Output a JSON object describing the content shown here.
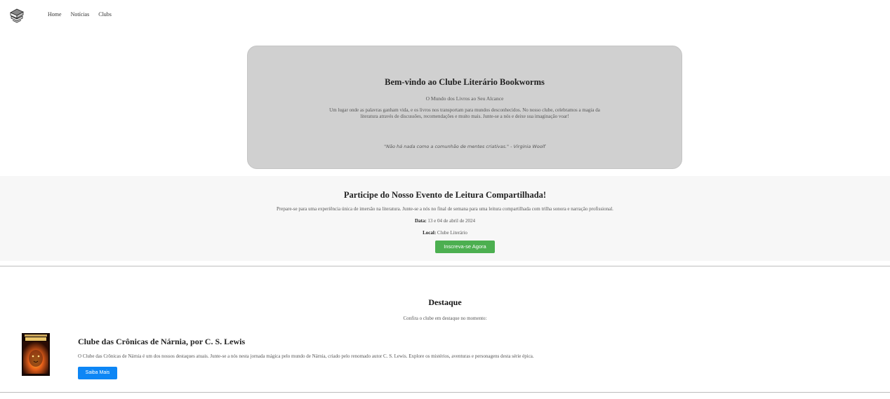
{
  "nav": {
    "logo_icon": "bookworm-books-logo",
    "links": [
      "Home",
      "Notícias",
      "Clubs"
    ]
  },
  "hero": {
    "title": "Bem-vindo ao Clube Literário Bookworms",
    "subtitle": "O Mundo dos Livros ao Seu Alcance",
    "body": "Um lugar onde as palavras ganham vida, e os livros nos transportam para mundos desconhecidos. No nosso clube, celebramos a magia da literatura através de discussões, recomendações e muito mais. Junte-se a nós e deixe sua imaginação voar!",
    "quote": "\"Não há nada como a comunhão de mentes criativas.\" - Virginia Woolf"
  },
  "event": {
    "title": "Participe do Nosso Evento de Leitura Compartilhada!",
    "description": "Prepare-se para uma experiência única de imersão na literatura. Junte-se a nós no final de semana para uma leitura compartilhada com trilha sonora e narração profissional.",
    "date_label": "Data:",
    "date_value": " 13 e 04 de abril de 2024",
    "place_label": "Local:",
    "place_value": " Clube Literário",
    "button": "Inscreva-se Agora"
  },
  "featured": {
    "title": "Destaque",
    "subtitle": "Confira o clube em destaque no momento:",
    "cover_icon": "narnia-book-cover",
    "club_title": "Clube das Crônicas de Nárnia, por C. S. Lewis",
    "club_description": "O Clube das Crônicas de Nárnia é um dos nossos destaques atuais. Junte-se a nós nesta jornada mágica pelo mundo de Nárnia, criado pelo renomado autor C. S. Lewis. Explore os mistérios, aventuras e personagens desta série épica.",
    "button": "Saiba Mais"
  },
  "colors": {
    "hero_bg": "#d0d0d0",
    "event_bg": "#f7f7f7",
    "button_green": "#4caf50",
    "button_blue": "#0d86f5"
  }
}
